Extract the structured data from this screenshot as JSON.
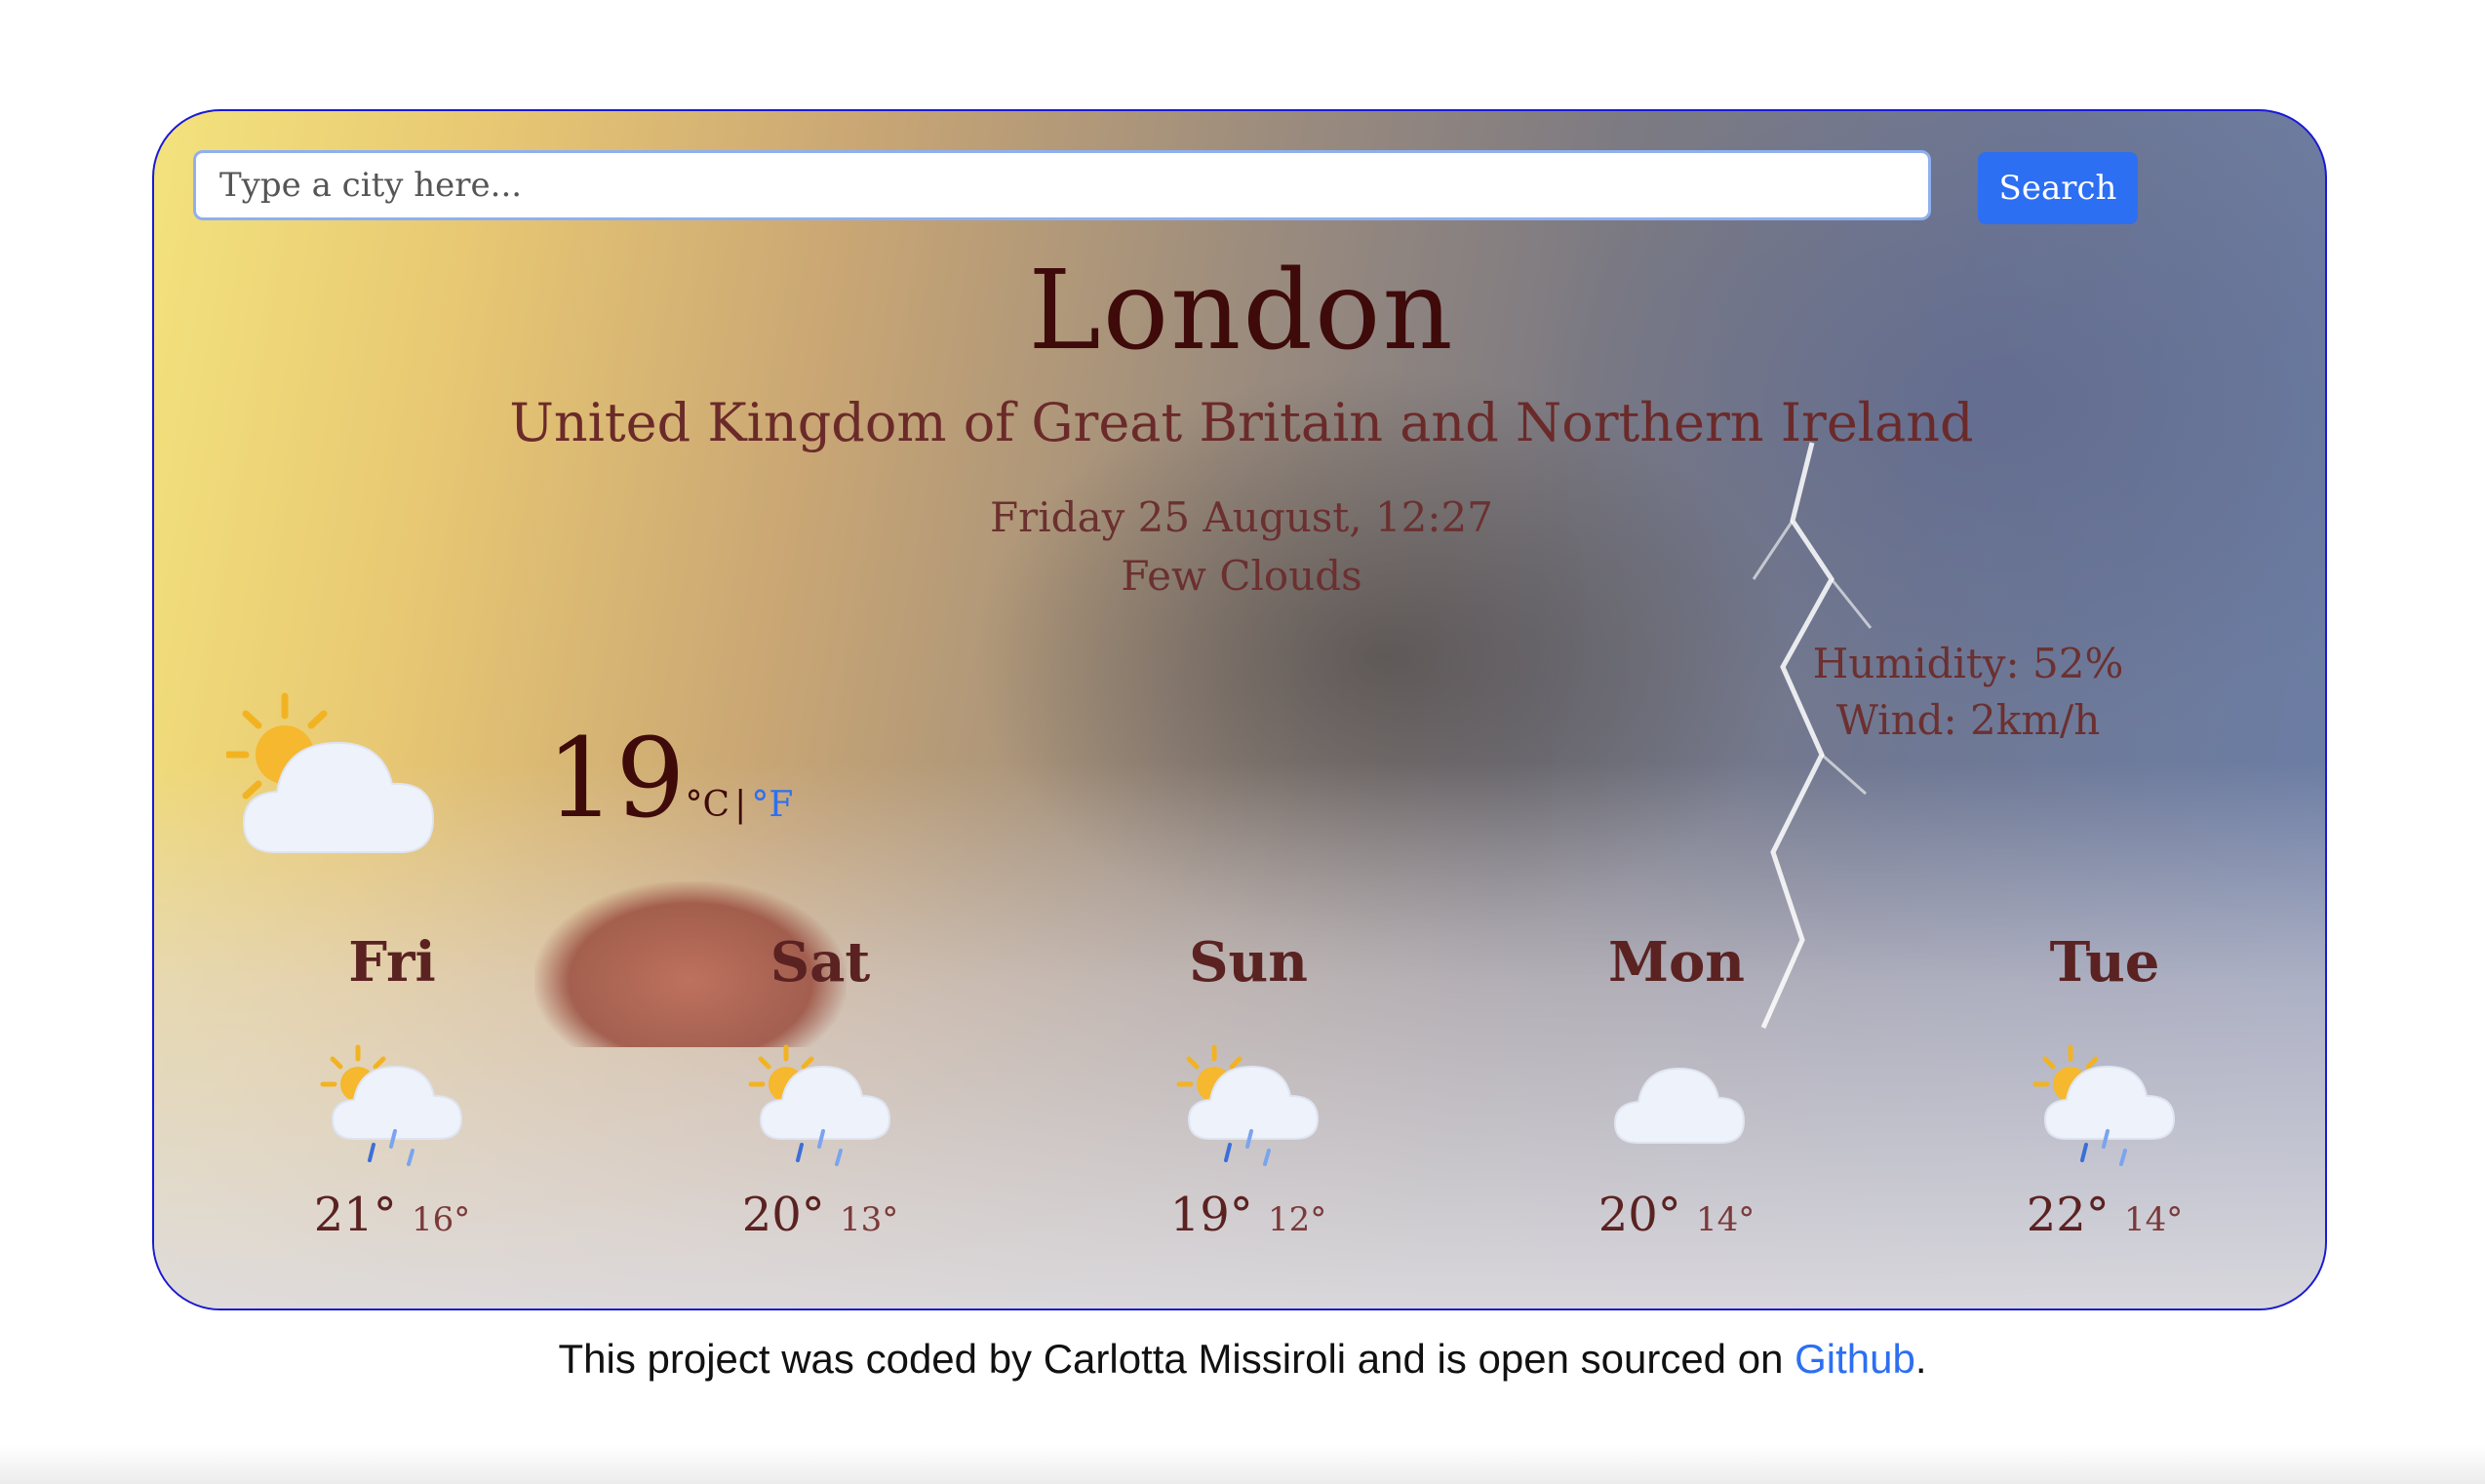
{
  "search": {
    "placeholder": "Type a city here...",
    "button_label": "Search"
  },
  "current": {
    "city": "London",
    "country": "United Kingdom of Great Britain and Northern Ireland",
    "datetime": "Friday 25 August, 12:27",
    "description": "Few Clouds",
    "humidity": "Humidity: 52%",
    "wind": "Wind: 2km/h",
    "temperature": "19",
    "unit_c": "°C",
    "separator": "|",
    "unit_f": "°F",
    "icon": "few-clouds-icon"
  },
  "forecast": [
    {
      "day": "Fri",
      "max": "21°",
      "min": "16°",
      "icon": "sun-rain-icon"
    },
    {
      "day": "Sat",
      "max": "20°",
      "min": "13°",
      "icon": "sun-rain-icon"
    },
    {
      "day": "Sun",
      "max": "19°",
      "min": "12°",
      "icon": "sun-rain-icon"
    },
    {
      "day": "Mon",
      "max": "20°",
      "min": "14°",
      "icon": "cloud-icon"
    },
    {
      "day": "Tue",
      "max": "22°",
      "min": "14°",
      "icon": "sun-rain-icon"
    }
  ],
  "footer": {
    "text_before": "This project was coded by Carlotta Missiroli and is open sourced on ",
    "link_label": "Github",
    "text_after": "."
  },
  "colors": {
    "accent": "#2d6ff2",
    "card_border": "#1a1ad6",
    "title": "#3f0a0a"
  }
}
